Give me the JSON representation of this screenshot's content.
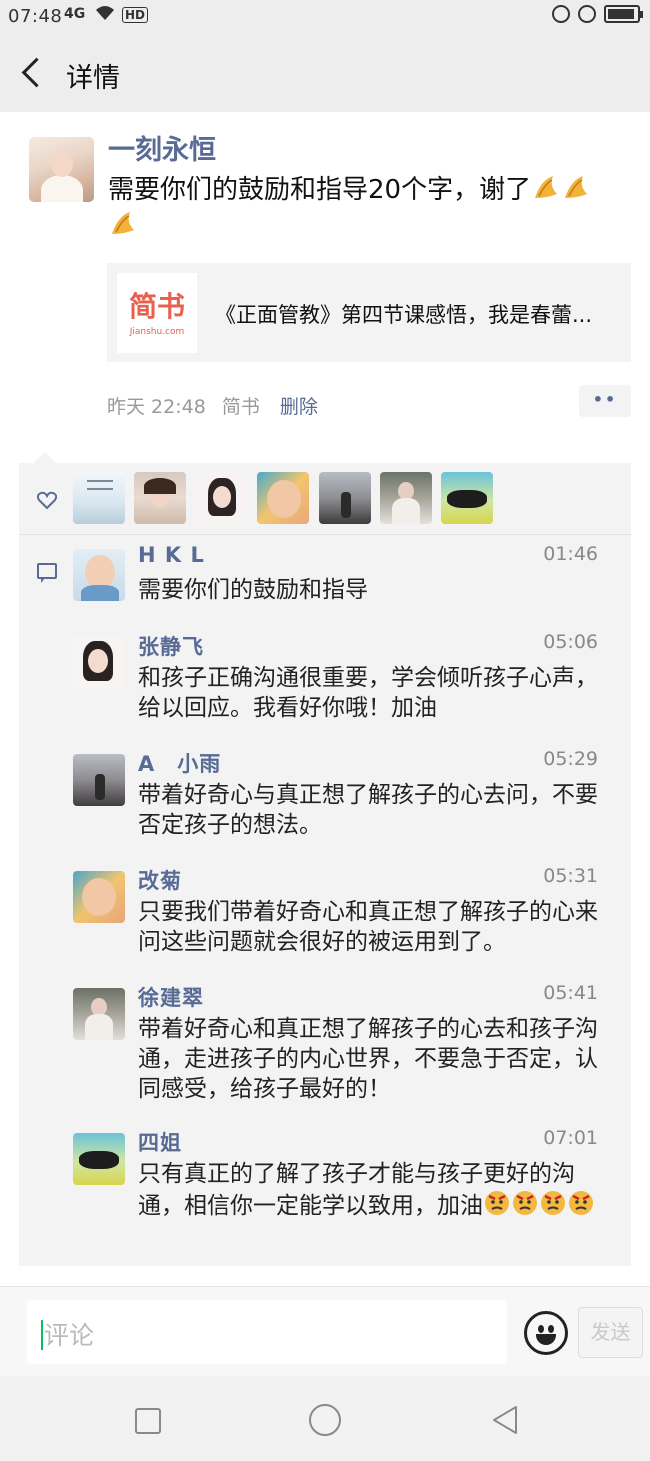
{
  "status_bar": {
    "time": "07:48",
    "signal": "4G",
    "hd": "HD"
  },
  "nav": {
    "title": "详情"
  },
  "post": {
    "author": "一刻永恒",
    "text": "需要你们的鼓励和指导20个字，谢了",
    "link": {
      "logo_text": "简书",
      "logo_sub": "Jianshu.com",
      "title": "《正面管教》第四节课感悟，我是春蕾..."
    },
    "time": "昨天 22:48",
    "source": "简书",
    "delete_label": "删除",
    "more_label": "••"
  },
  "likes": [
    {
      "name": "like-avatar-1"
    },
    {
      "name": "like-avatar-2"
    },
    {
      "name": "like-avatar-3"
    },
    {
      "name": "like-avatar-4"
    },
    {
      "name": "like-avatar-5"
    },
    {
      "name": "like-avatar-6"
    },
    {
      "name": "like-avatar-7"
    }
  ],
  "comments": [
    {
      "name": "H K L",
      "time": "01:46",
      "text": "需要你们的鼓励和指导"
    },
    {
      "name": "张静飞",
      "time": "05:06",
      "text": "和孩子正确沟通很重要，学会倾听孩子心声，给以回应。我看好你哦！加油"
    },
    {
      "name": "A　小雨",
      "time": "05:29",
      "text": "带着好奇心与真正想了解孩子的心去问，不要否定孩子的想法。"
    },
    {
      "name": "改菊",
      "time": "05:31",
      "text": "只要我们带着好奇心和真正想了解孩子的心来问这些问题就会很好的被运用到了。"
    },
    {
      "name": "徐建翠",
      "time": "05:41",
      "text": "带着好奇心和真正想了解孩子的心去和孩子沟通，走进孩子的内心世界，不要急于否定，认同感受，给孩子最好的！"
    },
    {
      "name": "四姐",
      "time": "07:01",
      "text": "只有真正的了解了孩子才能与孩子更好的沟通，相信你一定能学以致用，加油"
    }
  ],
  "input": {
    "placeholder": "评论",
    "send_label": "发送"
  },
  "colors": {
    "link_blue": "#576b95",
    "panel_bg": "#f3f3f3",
    "logo_red": "#e9604f",
    "caret_green": "#07c160"
  }
}
